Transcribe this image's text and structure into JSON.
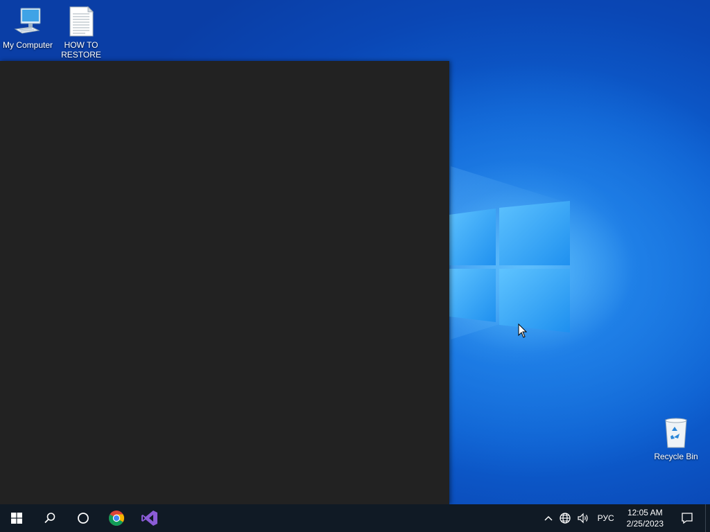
{
  "desktop": {
    "icons": [
      {
        "label": "My Computer",
        "icon": "computer-icon"
      },
      {
        "label": "HOW TO RESTORE",
        "icon": "text-document-icon"
      },
      {
        "label": "Recycle Bin",
        "icon": "recycle-bin-icon"
      }
    ]
  },
  "taskbar": {
    "start_icon": "windows-start-icon",
    "search_icon": "search-icon",
    "cortana_icon": "cortana-circle-icon",
    "pinned": [
      {
        "icon": "chrome-icon"
      },
      {
        "icon": "visual-studio-icon"
      }
    ],
    "tray": {
      "language": "РУС",
      "time": "12:05 AM",
      "date": "2/25/2023"
    }
  },
  "colors": {
    "taskbar": "#101a25",
    "window": "#222222",
    "wallpaper_accent": "#1a7fe6"
  }
}
